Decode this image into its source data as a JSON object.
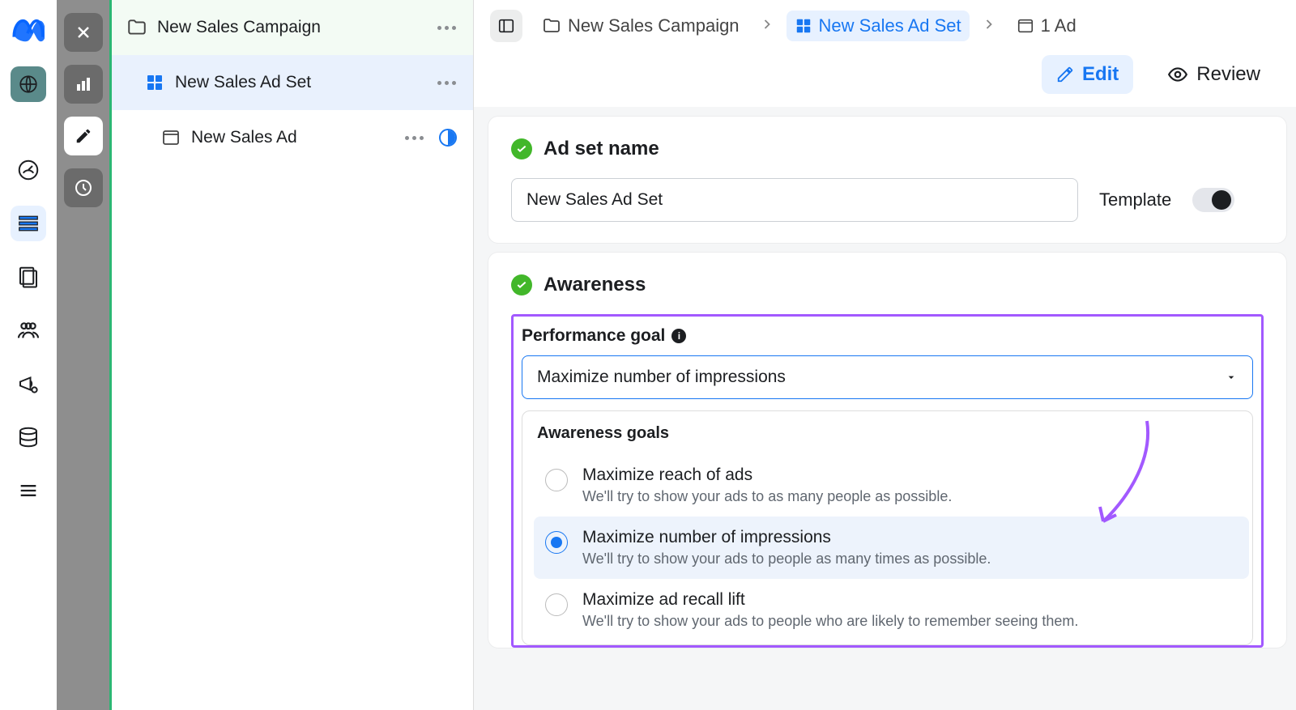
{
  "tree": {
    "campaign": "New Sales Campaign",
    "adset": "New Sales Ad Set",
    "ad": "New Sales Ad"
  },
  "breadcrumbs": {
    "campaign": "New Sales Campaign",
    "adset": "New Sales Ad Set",
    "ad": "1 Ad"
  },
  "actions": {
    "edit": "Edit",
    "review": "Review"
  },
  "adset_name_card": {
    "title": "Ad set name",
    "value": "New Sales Ad Set",
    "template_label": "Template"
  },
  "awareness_card": {
    "title": "Awareness",
    "perf_label": "Performance goal",
    "dropdown_value": "Maximize number of impressions",
    "options_head": "Awareness goals",
    "options": [
      {
        "title": "Maximize reach of ads",
        "desc": "We'll try to show your ads to as many people as possible."
      },
      {
        "title": "Maximize number of impressions",
        "desc": "We'll try to show your ads to people as many times as possible."
      },
      {
        "title": "Maximize ad recall lift",
        "desc": "We'll try to show your ads to people who are likely to remember seeing them."
      }
    ]
  }
}
